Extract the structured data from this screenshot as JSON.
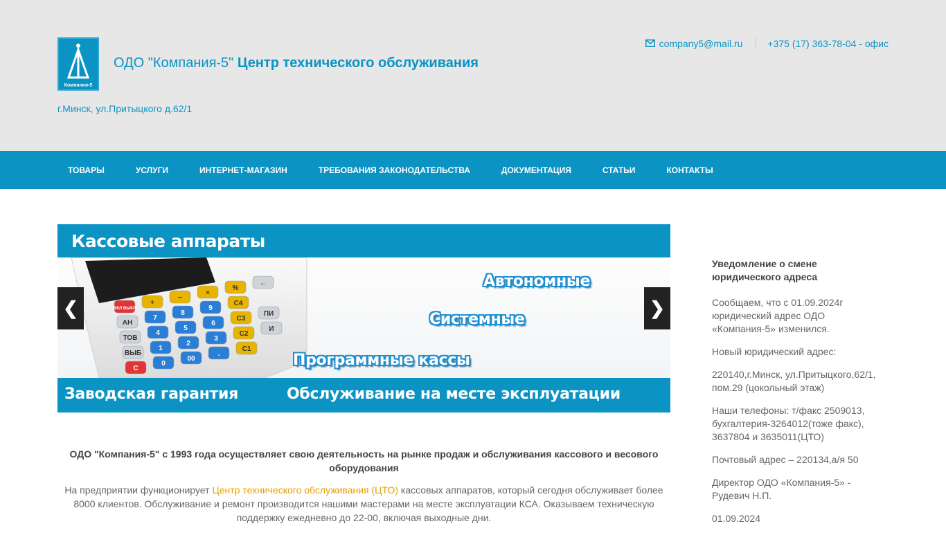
{
  "header": {
    "title_prefix": "ОДО \"Компания-5\"",
    "title_main": "Центр технического обслуживания",
    "address": "г.Минск, ул.Притыцкого д.62/1",
    "email": "company5@mail.ru",
    "phone": "+375 (17) 363-78-04 - офис",
    "logo_text": "Компания-5"
  },
  "nav": {
    "items": [
      {
        "label": "ТОВАРЫ"
      },
      {
        "label": "УСЛУГИ"
      },
      {
        "label": "ИНТЕРНЕТ-МАГАЗИН"
      },
      {
        "label": "ТРЕБОВАНИЯ ЗАКОНОДАТЕЛЬСТВА"
      },
      {
        "label": "ДОКУМЕНТАЦИЯ"
      },
      {
        "label": "СТАТЬИ"
      },
      {
        "label": "КОНТАКТЫ"
      }
    ]
  },
  "slider": {
    "top_text": "Кассовые аппараты",
    "tags": [
      "Автономные",
      "Системные",
      "Программные кассы"
    ],
    "bottom_left": "Заводская гарантия",
    "bottom_right": "Обслуживание на месте эксплуатации",
    "prev_label": "❮",
    "next_label": "❯",
    "keys": [
      "ВКЛ ВЫКЛ",
      "+",
      "−",
      "×",
      "%",
      "←",
      "АН",
      "7",
      "8",
      "9",
      "C4",
      "ТОВ",
      "4",
      "5",
      "6",
      "C3",
      "ПИ",
      "ВЫБ",
      "1",
      "2",
      "3",
      "C2",
      "И",
      "C",
      "0",
      "00",
      ".",
      "C1"
    ]
  },
  "intro": {
    "bold": "ОДО \"Компания-5\" с 1993 года осуществляет свою деятельность на рынке продаж и обслуживания кассового и весового оборудования",
    "text_before": "На предприятии функционирует ",
    "link": "Центр технического обслуживания (ЦТО)",
    "text_after": " кассовых аппаратов, который сегодня обслуживает более 8000 клиентов. Обслуживание и ремонт производится нашими мастерами на месте эксплуатации КСА. Оказываем техническую поддержку ежедневно до 22-00, включая выходные дни."
  },
  "sidebar": {
    "heading": "Уведомление о смене юридического адреса",
    "paragraphs": [
      "Сообщаем, что с 01.09.2024г юридический адрес ОДО «Компания-5» изменился.",
      "Новый юридический адрес:",
      "220140,г.Минск, ул.Притыцкого,62/1, пом.29 (цокольный этаж)",
      "Наши телефоны: т/факс 2509013, бухгалтерия-3264012(тоже факс), 3637804 и 3635011(ЦТО)",
      "Почтовый адрес – 220134,а/я 50",
      "Директор ОДО «Компания-5» - Рудевич Н.П.",
      "01.09.2024"
    ]
  },
  "colors": {
    "brand": "#0b93c4",
    "header_bg": "#e7e7e7",
    "link_accent": "#e6a100"
  },
  "icons": [
    "envelope-icon",
    "chevron-left-icon",
    "chevron-right-icon"
  ]
}
